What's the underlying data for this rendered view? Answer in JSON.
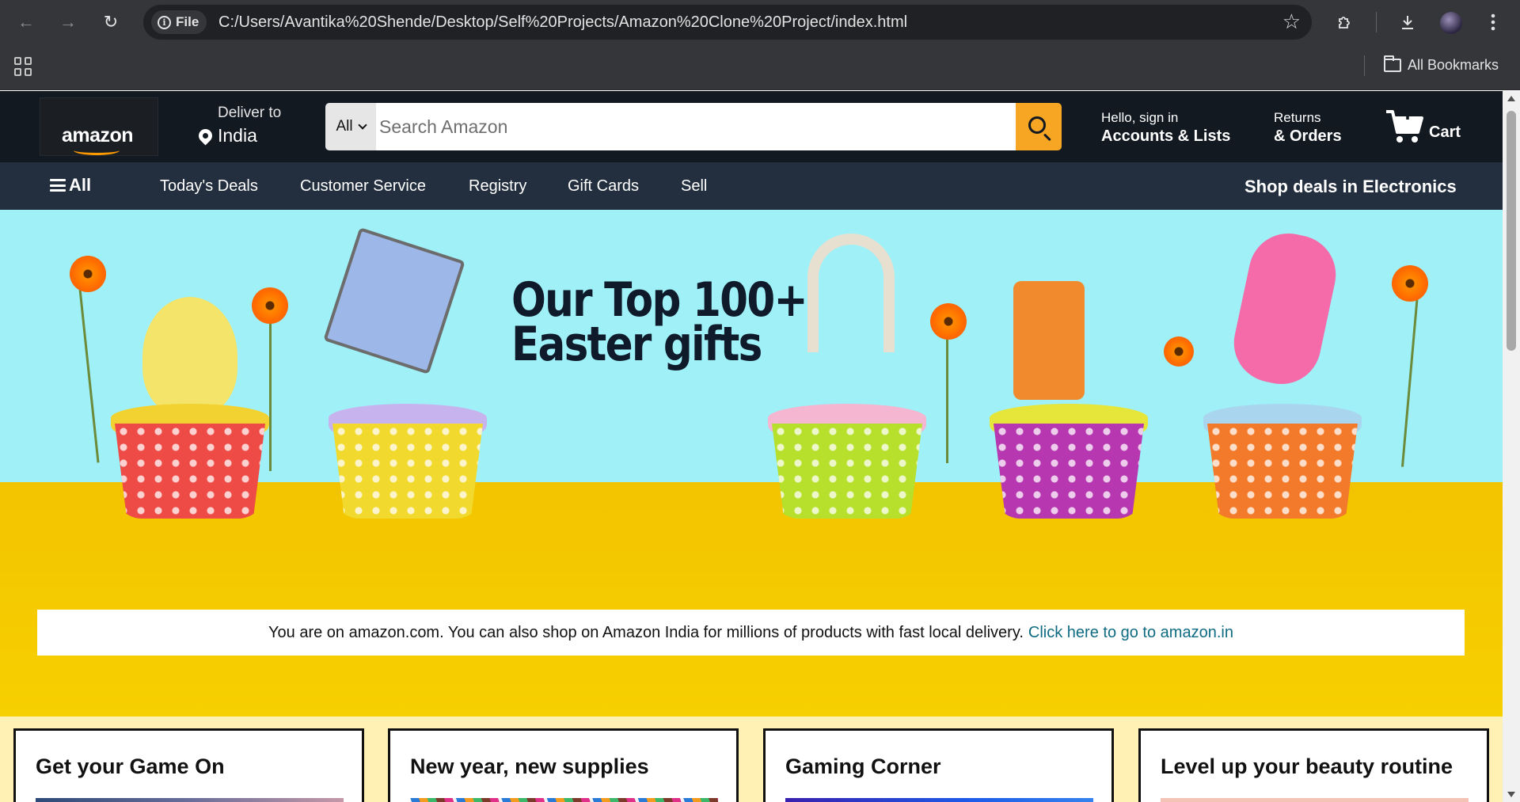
{
  "browser": {
    "site_chip": "File",
    "url": "C:/Users/Avantika%20Shende/Desktop/Self%20Projects/Amazon%20Clone%20Project/index.html",
    "all_bookmarks": "All Bookmarks",
    "icons": [
      "back-icon",
      "forward-icon",
      "reload-icon",
      "info-icon",
      "star-icon",
      "extensions-icon",
      "download-icon",
      "profile-avatar",
      "menu-icon",
      "apps-icon",
      "folder-icon"
    ]
  },
  "amazon_nav": {
    "logo": "amazon",
    "deliver_to": "Deliver to",
    "location": "India",
    "search_category": "All",
    "search_placeholder": "Search Amazon",
    "greeting": "Hello, sign in",
    "accounts": "Accounts & Lists",
    "returns": "Returns",
    "orders": "& Orders",
    "cart": "Cart"
  },
  "sub_nav": {
    "all": "All",
    "items": [
      "Today's Deals",
      "Customer Service",
      "Registry",
      "Gift Cards",
      "Sell"
    ],
    "promo": "Shop deals in Electronics"
  },
  "hero": {
    "title_line1": "Our Top 100+",
    "title_line2": "Easter gifts",
    "notice_text": "You are on amazon.com. You can also shop on Amazon India for millions of products with fast local delivery.",
    "notice_link": "Click here to go to amazon.in"
  },
  "cards": [
    {
      "title": "Get your Game On"
    },
    {
      "title": "New year, new supplies"
    },
    {
      "title": "Gaming Corner"
    },
    {
      "title": "Level up your beauty routine"
    }
  ],
  "colors": {
    "nav_bg": "#131921",
    "subnav_bg": "#232f3e",
    "accent": "#f6a623",
    "hero_sky": "#9ff0f7",
    "hero_floor": "#f2c400",
    "link": "#0f6b82"
  }
}
